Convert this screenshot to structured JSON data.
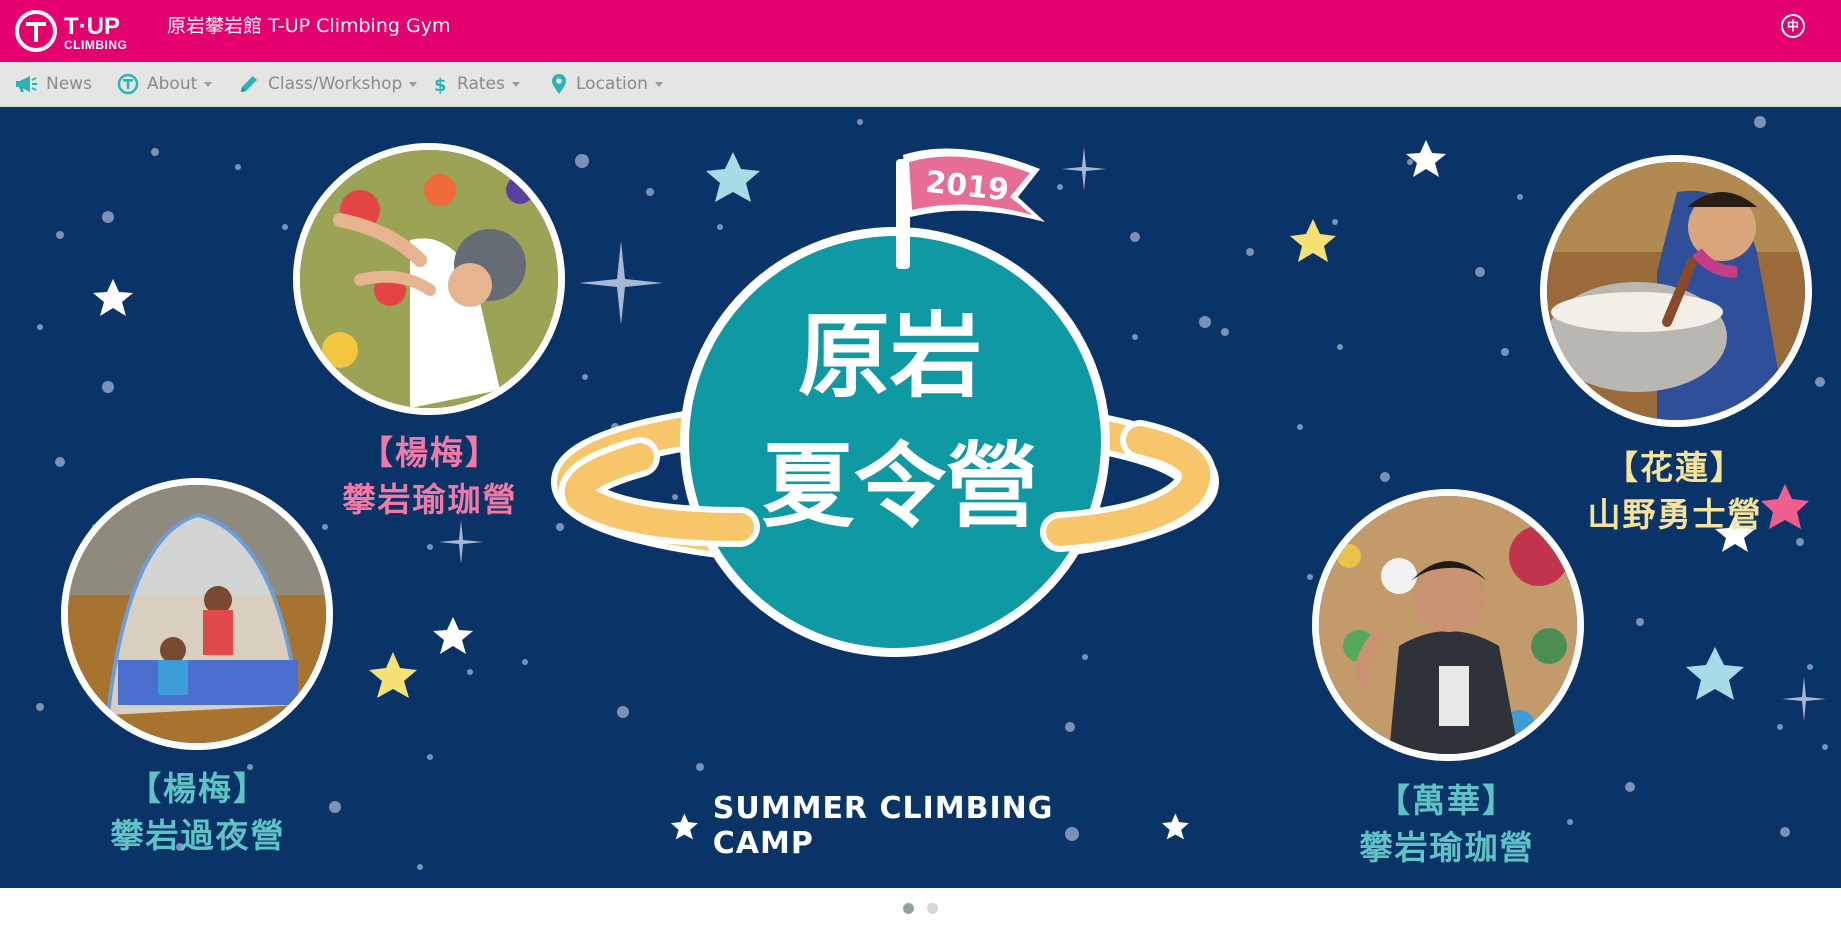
{
  "header": {
    "logo_main": "T·UP",
    "logo_sub": "CLIMBING",
    "site_title": "原岩攀岩館 T-UP Climbing Gym",
    "lang_label": "中"
  },
  "menu": {
    "items": [
      {
        "label": "News",
        "icon": "megaphone-icon",
        "has_dropdown": false
      },
      {
        "label": "About",
        "icon": "tup-circle-icon",
        "has_dropdown": true
      },
      {
        "label": "Class/Workshop",
        "icon": "pencil-icon",
        "has_dropdown": true
      },
      {
        "label": "Rates",
        "icon": "dollar-icon",
        "has_dropdown": true
      },
      {
        "label": "Location",
        "icon": "map-pin-icon",
        "has_dropdown": true
      }
    ]
  },
  "banner": {
    "flag_year": "2019",
    "planet_line1": "原岩",
    "planet_line2": "夏令營",
    "camp_text": "SUMMER CLIMBING CAMP",
    "captions": [
      {
        "line1": "【楊梅】",
        "line2": "攀岩瑜珈營"
      },
      {
        "line1": "【楊梅】",
        "line2": "攀岩過夜營"
      },
      {
        "line1": "【花蓮】",
        "line2": "山野勇士營"
      },
      {
        "line1": "【萬華】",
        "line2": "攀岩瑜珈營"
      }
    ]
  },
  "carousel": {
    "slide_count": 2,
    "active_index": 0
  },
  "colors": {
    "brand_pink": "#e5006f",
    "menu_bg": "#e5e5e5",
    "menu_icon": "#2ab3b8",
    "banner_bg": "#0a3468",
    "planet": "#0f9aa3",
    "ring": "#f7c66a"
  }
}
